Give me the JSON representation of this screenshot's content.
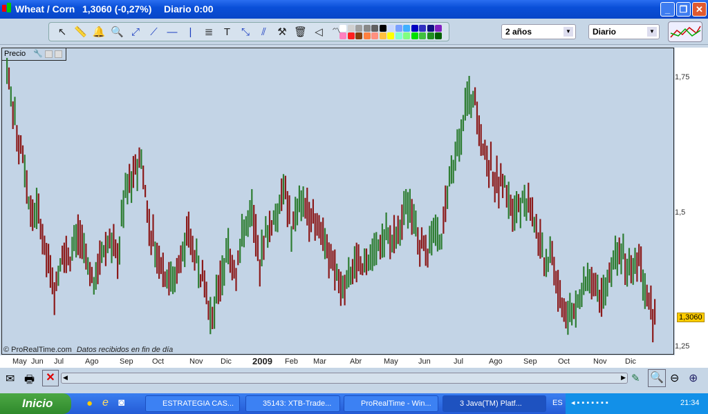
{
  "window": {
    "instrument": "Wheat / Corn",
    "price": "1,3060 (-0,27%)",
    "period_label": "Diario 0:00"
  },
  "toolbar": {
    "tools": [
      "pointer-icon",
      "ruler-icon",
      "alert-bell-icon",
      "zoom-icon",
      "segment-icon",
      "line-icon",
      "horizontal-line-icon",
      "vertical-line-icon",
      "indicator-icon",
      "text-icon",
      "channel-icon",
      "parallel-icon",
      "tools-icon",
      "trash-icon",
      "triangle-icon",
      "trend-icon"
    ],
    "palette": [
      "#ffffff",
      "#d0d0d0",
      "#a0a0a0",
      "#888888",
      "#606060",
      "#000000",
      "#c8d8ff",
      "#7aa0ff",
      "#40b0ff",
      "#0000c0",
      "#3030c0",
      "#101080",
      "#8020c0",
      "#ff80c0",
      "#ff2020",
      "#804010",
      "#ff8040",
      "#ff9080",
      "#ffc040",
      "#ffff00",
      "#80ffd0",
      "#80ff80",
      "#00e000",
      "#40c040",
      "#209020",
      "#006000"
    ],
    "range_select": "2 años",
    "interval_select": "Diario"
  },
  "panel": {
    "label": "Precio",
    "copyright": "© ProRealTime.com",
    "status": "Datos recibidos en fin de día"
  },
  "chart_data": {
    "type": "bar",
    "y_ticks": [
      "1,75",
      "1,5",
      "1,25"
    ],
    "ylim": [
      1.25,
      1.75
    ],
    "last_price_label": "1,3060",
    "x_labels": [
      "May",
      "Jun",
      "Jul",
      "Ago",
      "Sep",
      "Oct",
      "Nov",
      "Dic",
      "2009",
      "Feb",
      "Mar",
      "Abr",
      "May",
      "Jun",
      "Jul",
      "Ago",
      "Sep",
      "Oct",
      "Nov",
      "Dic"
    ],
    "closes": [
      1.773,
      1.664,
      1.61,
      1.49,
      1.5,
      1.41,
      1.36,
      1.43,
      1.42,
      1.46,
      1.41,
      1.37,
      1.43,
      1.45,
      1.41,
      1.56,
      1.57,
      1.6,
      1.48,
      1.43,
      1.39,
      1.38,
      1.41,
      1.46,
      1.41,
      1.36,
      1.29,
      1.38,
      1.43,
      1.39,
      1.47,
      1.5,
      1.41,
      1.47,
      1.5,
      1.55,
      1.47,
      1.52,
      1.51,
      1.47,
      1.46,
      1.41,
      1.38,
      1.36,
      1.41,
      1.39,
      1.42,
      1.43,
      1.45,
      1.45,
      1.48,
      1.52,
      1.46,
      1.42,
      1.46,
      1.46,
      1.55,
      1.61,
      1.7,
      1.72,
      1.64,
      1.59,
      1.56,
      1.55,
      1.51,
      1.52,
      1.52,
      1.47,
      1.41,
      1.42,
      1.34,
      1.3,
      1.33,
      1.36,
      1.38,
      1.36,
      1.36,
      1.41,
      1.42,
      1.4,
      1.42,
      1.34,
      1.306
    ],
    "up_color": "#2e7d32",
    "down_color": "#8b1a1a"
  },
  "bottom": {
    "icons": [
      "mail-icon",
      "print-icon",
      "disconnect-icon",
      "scroll-left-icon",
      "scroll-right-icon",
      "edit-icon",
      "auto-scale-icon",
      "zoom-out-icon",
      "zoom-in-icon"
    ]
  },
  "taskbar": {
    "start": "Inicio",
    "tasks": [
      "ESTRATEGIA CAS...",
      "35143: XTB-Trade...",
      "ProRealTime - Win...",
      "3 Java(TM) Platf..."
    ],
    "lang": "ES",
    "clock": "21:34"
  }
}
